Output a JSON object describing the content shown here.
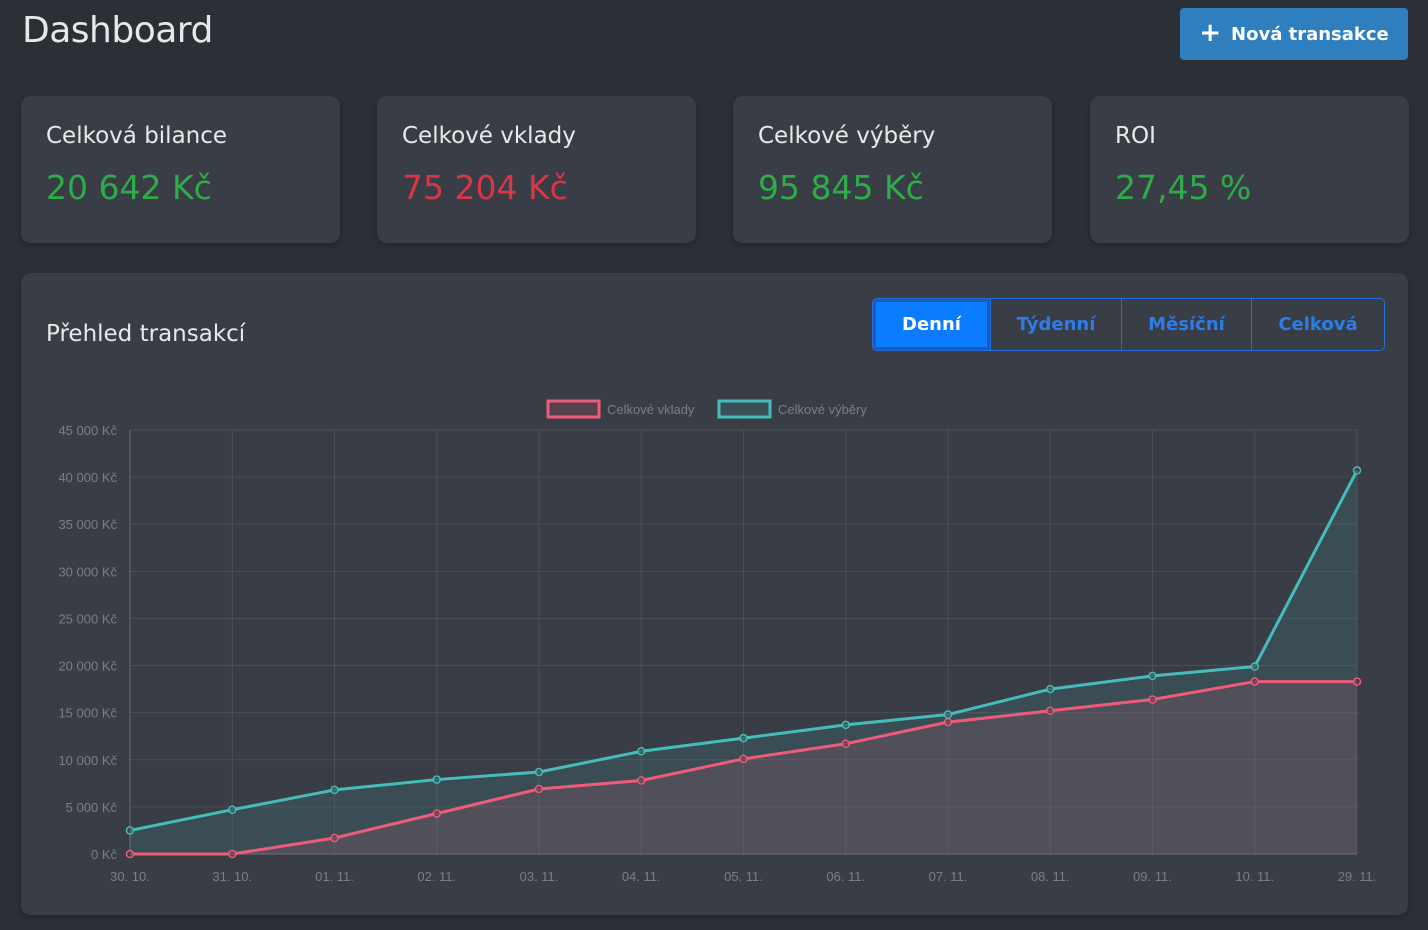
{
  "header": {
    "title": "Dashboard",
    "new_button_label": "Nová transakce",
    "new_button_icon": "plus-icon"
  },
  "cards": [
    {
      "label": "Celková bilance",
      "value": "20 642 Kč",
      "color": "#2eac48"
    },
    {
      "label": "Celkové vklady",
      "value": "75 204 Kč",
      "color": "#dc3545"
    },
    {
      "label": "Celkové výběry",
      "value": "95 845 Kč",
      "color": "#2eac48"
    },
    {
      "label": "ROI",
      "value": "27,45 %",
      "color": "#2eac48"
    }
  ],
  "panel": {
    "title": "Přehled transakcí",
    "tabs": [
      {
        "label": "Denní",
        "active": true
      },
      {
        "label": "Týdenní",
        "active": false
      },
      {
        "label": "Měsíční",
        "active": false
      },
      {
        "label": "Celková",
        "active": false
      }
    ]
  },
  "chart_data": {
    "type": "line",
    "x": [
      "30. 10.",
      "31. 10.",
      "01. 11.",
      "02. 11.",
      "03. 11.",
      "04. 11.",
      "05. 11.",
      "06. 11.",
      "07. 11.",
      "08. 11.",
      "09. 11.",
      "10. 11.",
      "29. 11."
    ],
    "ylim": [
      0,
      45000
    ],
    "yticks": [
      "0 Kč",
      "5 000 Kč",
      "10 000 Kč",
      "15 000 Kč",
      "20 000 Kč",
      "25 000 Kč",
      "30 000 Kč",
      "35 000 Kč",
      "40 000 Kč",
      "45 000 Kč"
    ],
    "ytick_values": [
      0,
      5000,
      10000,
      15000,
      20000,
      25000,
      30000,
      35000,
      40000,
      45000
    ],
    "grid": true,
    "legend_position": "top-center",
    "series": [
      {
        "name": "Celkové vklady",
        "color": "#ef5b7a",
        "fill": true,
        "values": [
          0,
          0,
          1700,
          4300,
          6900,
          7800,
          10100,
          11700,
          14000,
          15200,
          16400,
          18300,
          18300
        ]
      },
      {
        "name": "Celkové výběry",
        "color": "#45bdbd",
        "fill": true,
        "values": [
          2500,
          4700,
          6800,
          7900,
          8700,
          10900,
          12300,
          13700,
          14800,
          17500,
          18900,
          19900,
          40700
        ]
      }
    ]
  }
}
